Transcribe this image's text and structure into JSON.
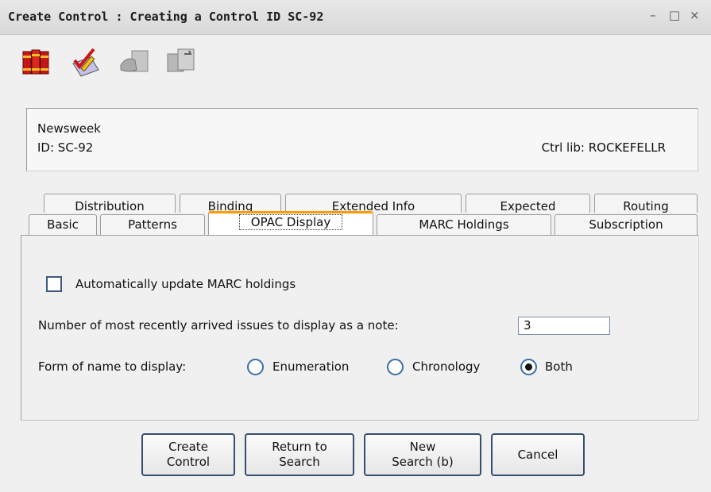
{
  "window": {
    "title": "Create Control : Creating a Control ID SC-92",
    "controls": {
      "minimize": "–",
      "maximize": "□",
      "close": "×"
    }
  },
  "toolbar": {
    "icons": [
      "books-icon",
      "checklist-pen-icon",
      "hand-document-icon",
      "copy-documents-icon"
    ]
  },
  "info": {
    "title": "Newsweek",
    "id": "ID: SC-92",
    "ctrl_lib": "Ctrl lib: ROCKEFELLR"
  },
  "tabs": {
    "back_row": [
      "Distribution",
      "Binding",
      "Extended Info",
      "Expected",
      "Routing"
    ],
    "front_row": [
      "Basic",
      "Patterns",
      "OPAC Display",
      "MARC Holdings",
      "Subscription"
    ],
    "active": "OPAC Display"
  },
  "opac": {
    "auto_update_label": "Automatically update MARC holdings",
    "auto_update_checked": false,
    "recent_issues_label": "Number of most recently arrived issues to display as a note:",
    "recent_issues_value": "3",
    "form_name_label": "Form of name to display:",
    "options": [
      "Enumeration",
      "Chronology",
      "Both"
    ],
    "selected": "Both"
  },
  "buttons": {
    "create_line1": "Create",
    "create_line2": "Control",
    "return_line1": "Return to",
    "return_line2": "Search",
    "new_line1": "New",
    "new_line2": "Search (b)",
    "cancel": "Cancel"
  },
  "colors": {
    "active_tab_accent": "#ff9c00",
    "button_border": "#354f6e"
  }
}
